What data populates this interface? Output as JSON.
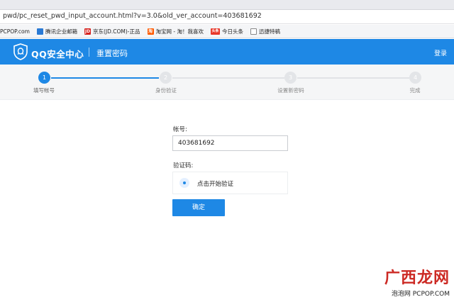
{
  "browser": {
    "url": "pwd/pc_reset_pwd_input_account.html?v=3.0&old_ver_account=403681692",
    "bookmarks": [
      {
        "label": "PCPOP.com",
        "icon": "site-icon",
        "color": "#ffffff"
      },
      {
        "label": "腾讯企业邮箱",
        "icon": "mail-icon",
        "color": "#2a7ad5"
      },
      {
        "label": "京东(JD.COM)-正品",
        "icon": "jd-icon",
        "color": "#d6201c",
        "badge": "JD"
      },
      {
        "label": "淘宝网 - 淘！我喜欢",
        "icon": "taobao-icon",
        "color": "#ff5a00",
        "badge": "淘"
      },
      {
        "label": "今日头条",
        "icon": "toutiao-icon",
        "color": "#e8382a",
        "badge": "头条"
      },
      {
        "label": "迅捷特稿",
        "icon": "document-icon",
        "color": "#888888"
      }
    ]
  },
  "header": {
    "brand": "QQ安全中心",
    "page_name": "重置密码",
    "login": "登录",
    "color": "#1e88e5"
  },
  "steps": [
    {
      "number": "1",
      "label": "填写帐号",
      "active": true
    },
    {
      "number": "2",
      "label": "身份验证",
      "active": false
    },
    {
      "number": "3",
      "label": "设置新密码",
      "active": false
    },
    {
      "number": "4",
      "label": "完成",
      "active": false
    }
  ],
  "form": {
    "account_label": "帐号:",
    "account_value": "403681692",
    "captcha_label": "验证码:",
    "captcha_text": "点击开始验证",
    "submit_label": "确定"
  },
  "watermark": {
    "title": "广西龙网",
    "subtitle": "泡泡网 PCPOP.COM"
  }
}
